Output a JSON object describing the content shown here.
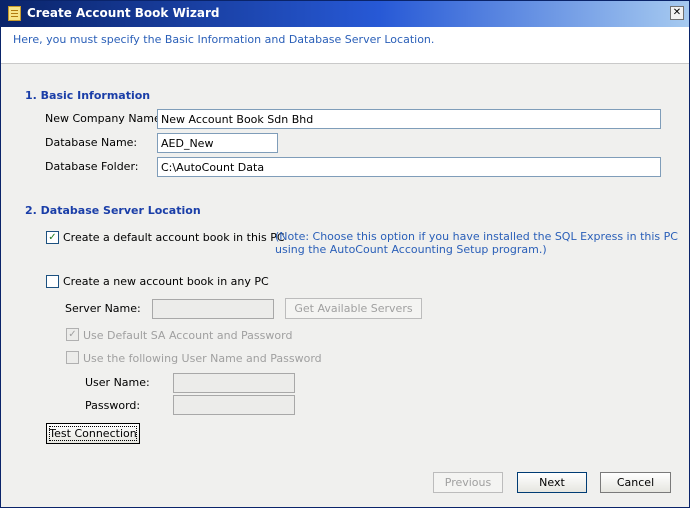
{
  "window": {
    "title": "Create Account Book Wizard",
    "close_glyph": "✕"
  },
  "header": {
    "instruction": "Here, you must specify the Basic Information and Database Server Location."
  },
  "basic_info": {
    "title": "1. Basic Information",
    "company_name_label": "New Company Name:",
    "company_name_value": "New Account Book Sdn Bhd",
    "database_name_label": "Database Name:",
    "database_name_value": "AED_New",
    "database_folder_label": "Database Folder:",
    "database_folder_value": "C:\\AutoCount Data"
  },
  "server_location": {
    "title": "2. Database Server Location",
    "default_pc_label": "Create a default account book in this PC",
    "default_pc_checked": true,
    "note_line1": "(Note: Choose this option if you have installed the SQL Express in this PC",
    "note_line2": "using the AutoCount Accounting Setup program.)",
    "any_pc_label": "Create a new account book in any PC",
    "any_pc_checked": false,
    "server_name_label": "Server Name:",
    "server_name_value": "",
    "get_servers_label": "Get Available Servers",
    "default_sa_label": "Use Default SA Account and Password",
    "default_sa_checked": true,
    "user_pass_label": "Use the following User Name and Password",
    "user_pass_checked": false,
    "user_name_label": "User Name:",
    "user_name_value": "",
    "password_label": "Password:",
    "password_value": "",
    "test_connection_label": "Test Connection"
  },
  "footer": {
    "previous_label": "Previous",
    "next_label": "Next",
    "cancel_label": "Cancel"
  },
  "colors": {
    "title_bar": "#0a246a",
    "section_title": "#1a3ea8",
    "note_text": "#2a5fb8",
    "check_mark": "#1f7a1f"
  },
  "icons": {
    "check_glyph": "✓"
  }
}
